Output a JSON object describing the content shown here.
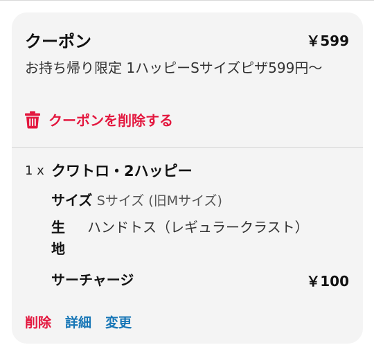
{
  "coupon": {
    "title": "クーポン",
    "price": "￥599",
    "description": "お持ち帰り限定 1ハッピーSサイズピザ599円〜",
    "remove_label": "クーポンを削除する"
  },
  "item": {
    "quantity": "1 x",
    "name": "クワトロ・2ハッピー",
    "size_key": "サイズ",
    "size_value": "Sサイズ (旧Mサイズ)",
    "dough_key": "生地",
    "dough_value": "ハンドトス（レギュラークラスト）",
    "surcharge_label": "サーチャージ",
    "surcharge_price": "￥100",
    "actions": {
      "delete": "削除",
      "detail": "詳細",
      "change": "変更"
    }
  },
  "colors": {
    "accent_red": "#e3173e",
    "link_blue": "#1776b6",
    "card_bg": "#f4f4f4"
  },
  "icons": {
    "remove": "trash-icon"
  }
}
